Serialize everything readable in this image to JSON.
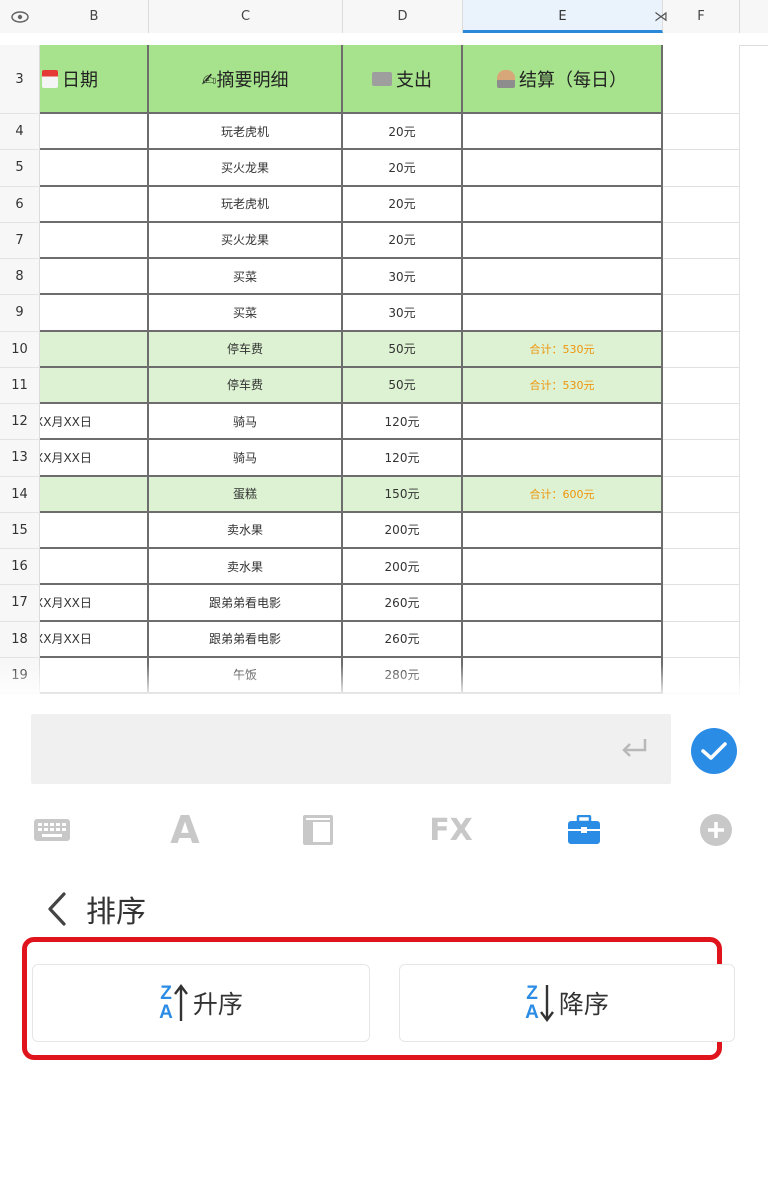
{
  "column_headers": [
    "B",
    "C",
    "D",
    "E",
    "F"
  ],
  "resize_glyph": "⋊",
  "header_row": {
    "num": "3",
    "date": "日期",
    "detail": "✍摘要明细",
    "expense": "支出",
    "settle": "结算（每日）"
  },
  "rows": [
    {
      "num": "4",
      "date": "",
      "detail": "玩老虎机",
      "expense": "20元",
      "settle": "",
      "green": false
    },
    {
      "num": "5",
      "date": "",
      "detail": "买火龙果",
      "expense": "20元",
      "settle": "",
      "green": false
    },
    {
      "num": "6",
      "date": "",
      "detail": "玩老虎机",
      "expense": "20元",
      "settle": "",
      "green": false
    },
    {
      "num": "7",
      "date": "",
      "detail": "买火龙果",
      "expense": "20元",
      "settle": "",
      "green": false
    },
    {
      "num": "8",
      "date": "",
      "detail": "买菜",
      "expense": "30元",
      "settle": "",
      "green": false
    },
    {
      "num": "9",
      "date": "",
      "detail": "买菜",
      "expense": "30元",
      "settle": "",
      "green": false
    },
    {
      "num": "10",
      "date": "",
      "detail": "停车费",
      "expense": "50元",
      "settle": "合计：530元",
      "green": true
    },
    {
      "num": "11",
      "date": "",
      "detail": "停车费",
      "expense": "50元",
      "settle": "合计：530元",
      "green": true
    },
    {
      "num": "12",
      "date": "XX月XX日",
      "detail": "骑马",
      "expense": "120元",
      "settle": "",
      "green": false
    },
    {
      "num": "13",
      "date": "XX月XX日",
      "detail": "骑马",
      "expense": "120元",
      "settle": "",
      "green": false
    },
    {
      "num": "14",
      "date": "",
      "detail": "蛋糕",
      "expense": "150元",
      "settle": "合计：600元",
      "green": true
    },
    {
      "num": "15",
      "date": "",
      "detail": "卖水果",
      "expense": "200元",
      "settle": "",
      "green": false
    },
    {
      "num": "16",
      "date": "",
      "detail": "卖水果",
      "expense": "200元",
      "settle": "",
      "green": false
    },
    {
      "num": "17",
      "date": "XX月XX日",
      "detail": "跟弟弟看电影",
      "expense": "260元",
      "settle": "",
      "green": false
    },
    {
      "num": "18",
      "date": "XX月XX日",
      "detail": "跟弟弟看电影",
      "expense": "260元",
      "settle": "",
      "green": false
    },
    {
      "num": "19",
      "date": "",
      "detail": "午饭",
      "expense": "280元",
      "settle": "",
      "green": false
    }
  ],
  "input_bar": {
    "value": "",
    "enter_icon": "return-icon",
    "confirm_icon": "checkmark-icon"
  },
  "toolbar": [
    {
      "name": "keyboard-icon",
      "label": ""
    },
    {
      "name": "font-icon",
      "label": "A"
    },
    {
      "name": "layout-icon",
      "label": ""
    },
    {
      "name": "formula-icon",
      "label": "FX"
    },
    {
      "name": "toolbox-icon",
      "label": "",
      "active": true
    },
    {
      "name": "add-icon",
      "label": ""
    }
  ],
  "sort_panel": {
    "title": "排序",
    "ascending_label": "升序",
    "descending_label": "降序",
    "za_top": "Z",
    "za_bottom": "A"
  },
  "colors": {
    "accent": "#2b8ce6",
    "header_green": "#a6e38c",
    "row_green": "#dcf2d2",
    "total_orange": "#f0950c",
    "highlight_red": "#e0141c"
  }
}
